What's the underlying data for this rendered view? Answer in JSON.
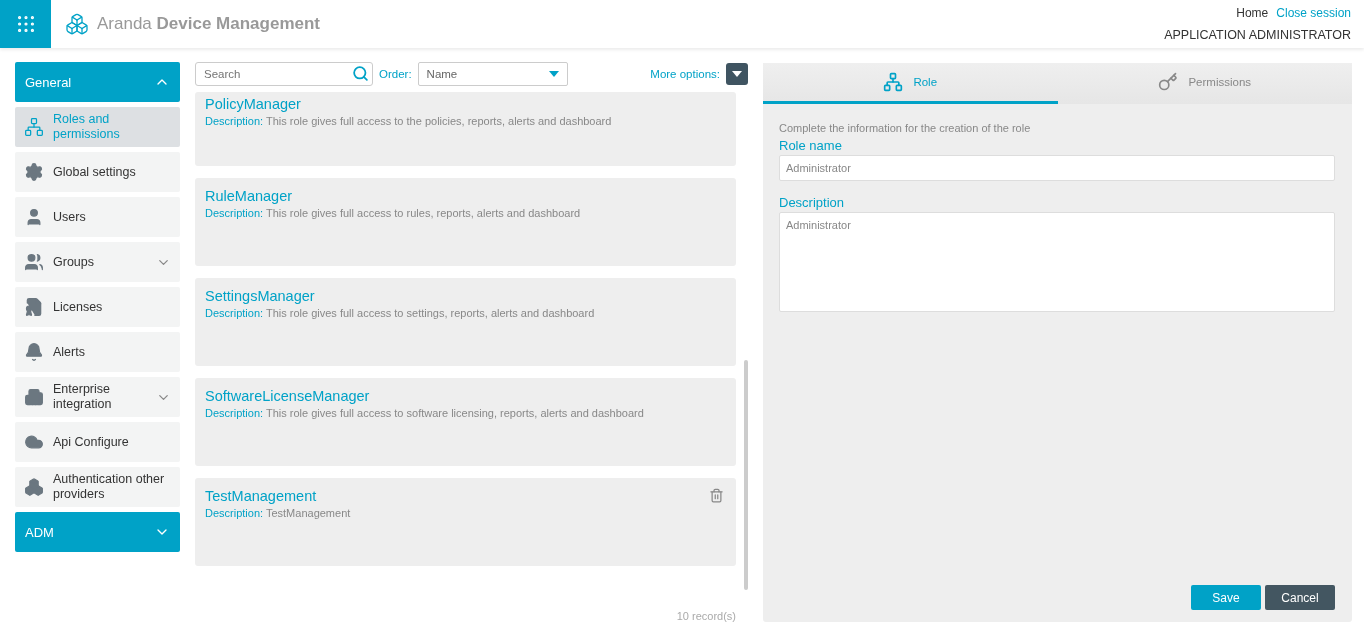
{
  "header": {
    "brand_light": "Aranda",
    "brand_bold": "Device Management",
    "links": [
      {
        "label": "Home",
        "kind": "plain"
      },
      {
        "label": "Close session",
        "kind": "link"
      }
    ],
    "user_role": "APPLICATION ADMINISTRATOR"
  },
  "sidebar": {
    "sections": [
      {
        "label": "General",
        "expanded": true,
        "items": [
          {
            "label": "Roles and permissions",
            "selected": true,
            "has_submenu": false
          },
          {
            "label": "Global settings",
            "selected": false,
            "has_submenu": false
          },
          {
            "label": "Users",
            "selected": false,
            "has_submenu": false
          },
          {
            "label": "Groups",
            "selected": false,
            "has_submenu": true
          },
          {
            "label": "Licenses",
            "selected": false,
            "has_submenu": false
          },
          {
            "label": "Alerts",
            "selected": false,
            "has_submenu": false
          },
          {
            "label": "Enterprise integration",
            "selected": false,
            "has_submenu": true
          },
          {
            "label": "Api Configure",
            "selected": false,
            "has_submenu": false
          },
          {
            "label": "Authentication other providers",
            "selected": false,
            "has_submenu": false
          }
        ]
      },
      {
        "label": "ADM",
        "expanded": false
      }
    ]
  },
  "toolbar": {
    "search": {
      "placeholder": "Search"
    },
    "order_label": "Order:",
    "order_value": "Name",
    "more_options": "More options:"
  },
  "roles": [
    {
      "name": "PolicyManager",
      "description_label": "Description:",
      "description": "This role gives full access to the policies, reports, alerts and dashboard",
      "deletable": false
    },
    {
      "name": "RuleManager",
      "description_label": "Description:",
      "description": "This role gives full access to rules, reports, alerts and dashboard",
      "deletable": false
    },
    {
      "name": "SettingsManager",
      "description_label": "Description:",
      "description": "This role gives full access to settings, reports, alerts and dashboard",
      "deletable": false
    },
    {
      "name": "SoftwareLicenseManager",
      "description_label": "Description:",
      "description": "This role gives full access to software licensing, reports, alerts and dashboard",
      "deletable": false
    },
    {
      "name": "TestManagement",
      "description_label": "Description:",
      "description": "TestManagement",
      "deletable": true
    }
  ],
  "record_count": "10 record(s)",
  "editor": {
    "tabs": [
      {
        "label": "Role",
        "selected": true
      },
      {
        "label": "Permissions",
        "selected": false
      }
    ],
    "intro": "Complete the information for the creation of the role",
    "fields": [
      {
        "label": "Role name",
        "value": "Administrator",
        "kind": "input"
      },
      {
        "label": "Description",
        "value": "Administrator",
        "kind": "textarea"
      }
    ],
    "buttons": [
      {
        "label": "Save",
        "kind": "primary"
      },
      {
        "label": "Cancel",
        "kind": "secondary"
      }
    ]
  }
}
